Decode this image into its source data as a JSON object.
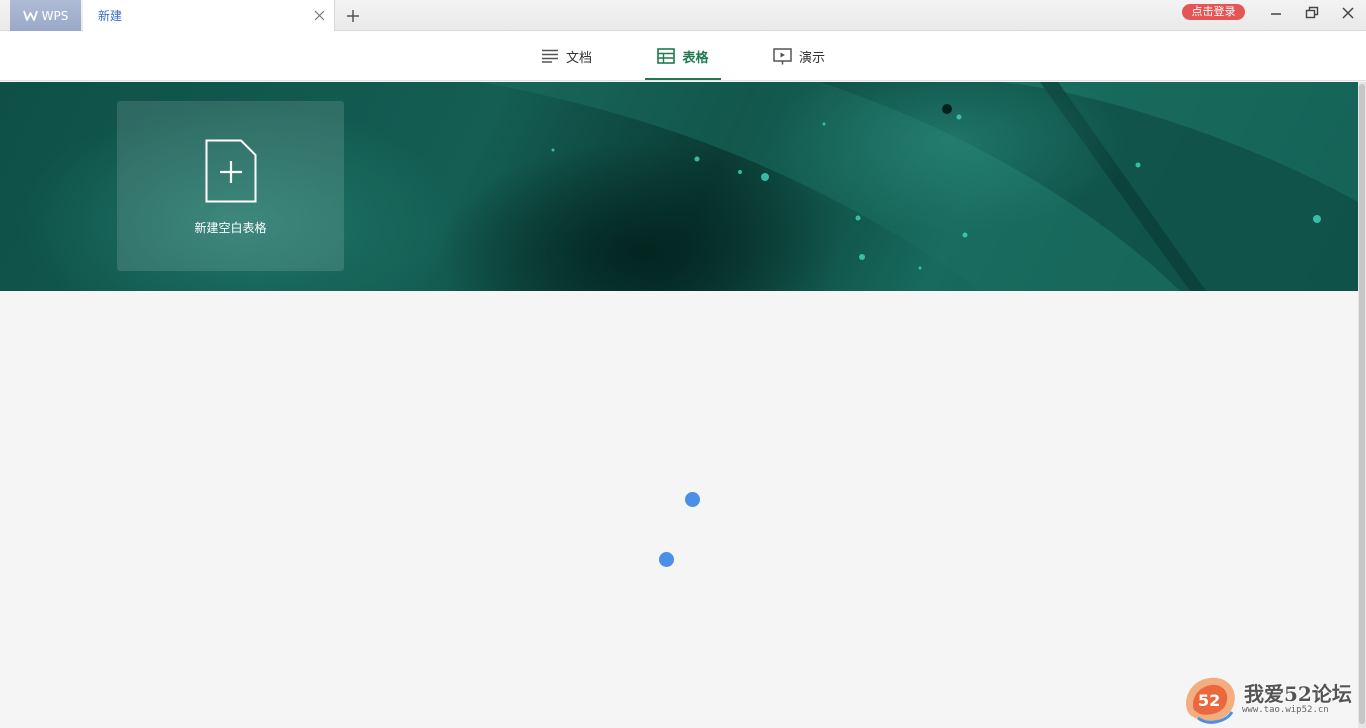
{
  "titlebar": {
    "app_tab_label": "WPS",
    "doc_tab_label": "新建",
    "login_label": "点击登录"
  },
  "categories": {
    "doc": "文档",
    "sheet": "表格",
    "show": "演示",
    "active": "表格"
  },
  "banner": {
    "new_blank_label": "新建空白表格"
  },
  "watermark": {
    "logo_text": "52",
    "main": "我爱52论坛",
    "sub": "www.tao.wip52.cn"
  },
  "colors": {
    "accent": "#1f7a4f",
    "login_badge": "#e65555",
    "spinner": "#4a8fe8",
    "tab_text": "#3b6fc4"
  }
}
